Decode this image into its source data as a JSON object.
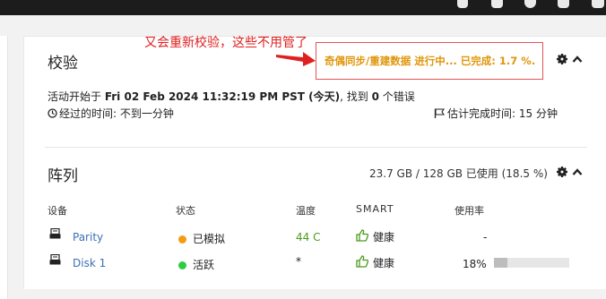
{
  "annotation": "又会重新校验，这些不用管了",
  "check": {
    "title": "校验",
    "status": "奇偶同步/重建数据 进行中... 已完成: 1.7 %.",
    "started_prefix": "活动开始于 ",
    "started_date": "Fri 02 Feb 2024 11:32:19 PM PST (今天)",
    "found_text": ", 找到 ",
    "error_count": "0",
    "error_suffix": " 个错误",
    "elapsed_label": "经过的时间: 不到一分钟",
    "estimate_label": "估计完成时间: 15 分钟"
  },
  "array": {
    "title": "阵列",
    "usage": "23.7 GB / 128 GB 已使用 (18.5 %)",
    "columns": [
      "设备",
      "状态",
      "温度",
      "SMART",
      "使用率"
    ],
    "rows": [
      {
        "device": "Parity",
        "status": "已模拟",
        "status_color": "#f39c12",
        "temp": "44 C",
        "temp_color": "#4a9a1c",
        "smart": "健康",
        "usage_text": "-",
        "usage_fraction": null
      },
      {
        "device": "Disk 1",
        "status": "活跃",
        "status_color": "#2ecc40",
        "temp": "*",
        "temp_color": "#222222",
        "smart": "健康",
        "usage_text": "18%",
        "usage_fraction": 0.18
      }
    ]
  },
  "controls": {
    "gear": "gear-icon",
    "collapse": "chevron-up-icon"
  }
}
